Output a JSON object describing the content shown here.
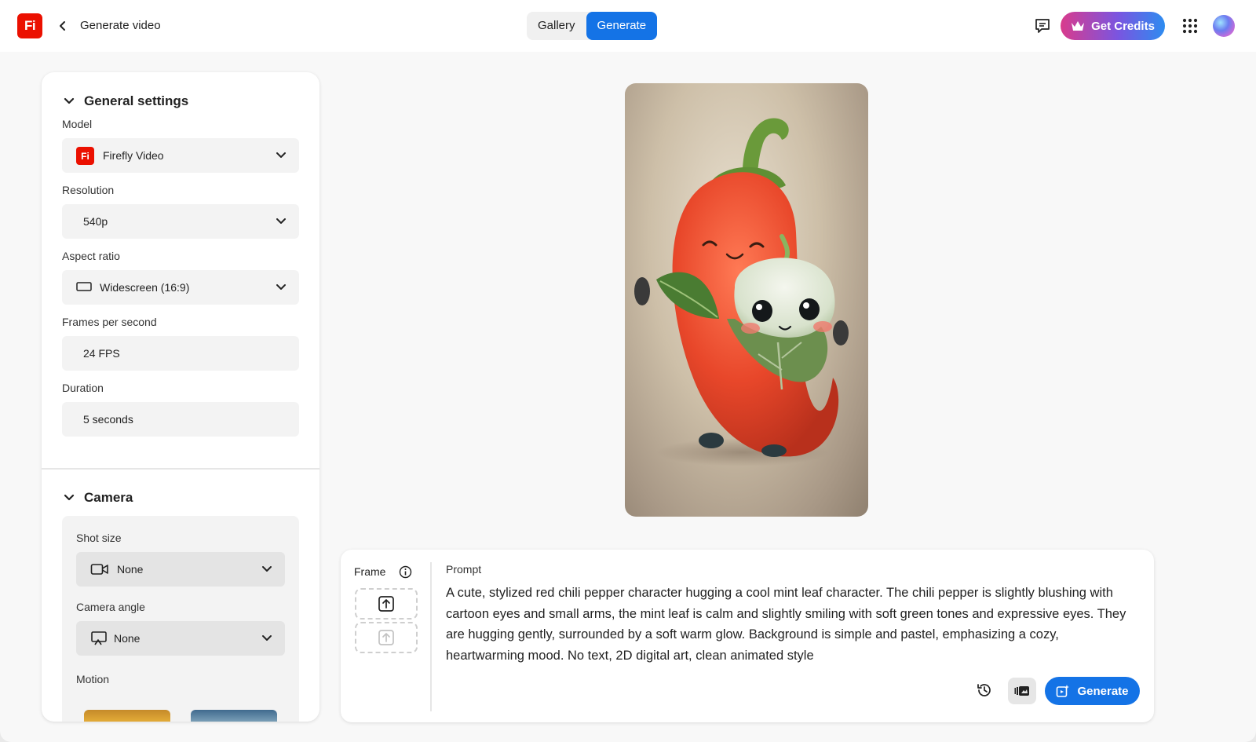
{
  "header": {
    "logo_text": "Fi",
    "page_title": "Generate video",
    "tabs": [
      {
        "label": "Gallery",
        "active": false
      },
      {
        "label": "Generate",
        "active": true
      }
    ],
    "credits_label": "Get Credits",
    "accent_color": "#1473e6",
    "brand_color": "#eb1000"
  },
  "general_settings": {
    "title": "General settings",
    "model": {
      "label": "Model",
      "value": "Firefly Video",
      "icon_text": "Fi"
    },
    "resolution": {
      "label": "Resolution",
      "value": "540p"
    },
    "aspect_ratio": {
      "label": "Aspect ratio",
      "value": "Widescreen (16:9)"
    },
    "fps": {
      "label": "Frames per second",
      "value": "24 FPS"
    },
    "duration": {
      "label": "Duration",
      "value": "5 seconds"
    }
  },
  "camera": {
    "title": "Camera",
    "shot_size": {
      "label": "Shot size",
      "value": "None"
    },
    "camera_angle": {
      "label": "Camera angle",
      "value": "None"
    },
    "motion": {
      "label": "Motion"
    }
  },
  "prompt_panel": {
    "frame_label": "Frame",
    "prompt_label": "Prompt",
    "prompt_text": "A cute, stylized red chili pepper character hugging a cool mint leaf character. The chili pepper is slightly blushing with cartoon eyes and small arms, the mint leaf is calm and slightly smiling with soft green tones and expressive eyes. They are hugging gently, surrounded by a soft warm glow. Background is simple and pastel, emphasizing a cozy, heartwarming mood. No text, 2D digital art, clean animated style",
    "generate_label": "Generate"
  }
}
